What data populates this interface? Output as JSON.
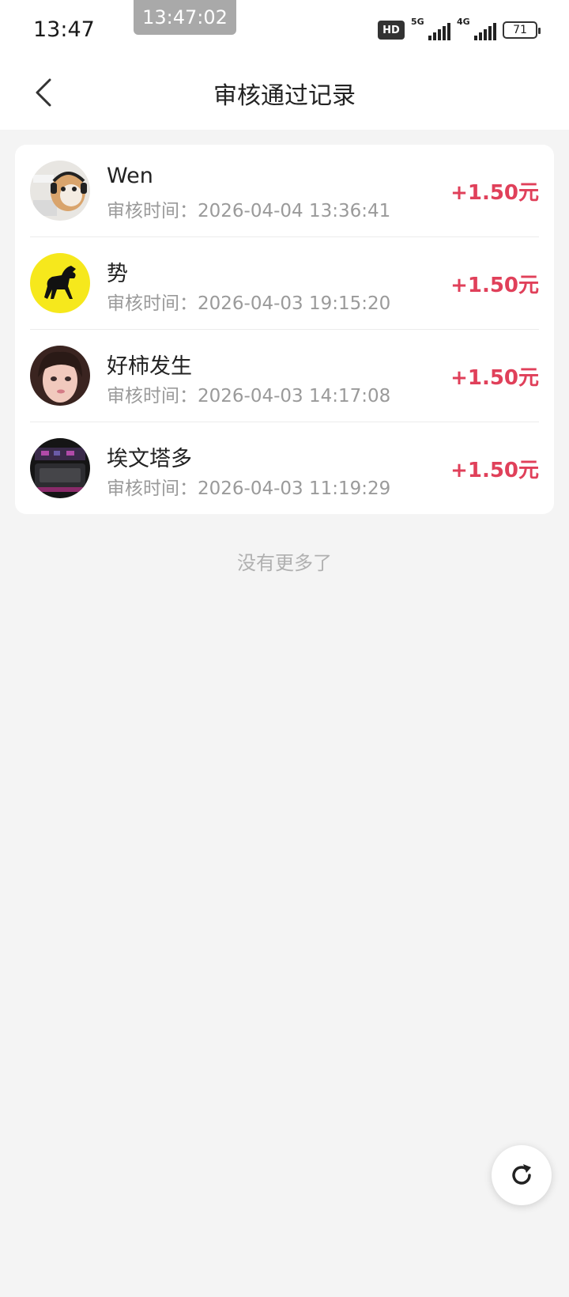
{
  "status_bar": {
    "time": "13:47",
    "clock_overlay": "13:47:02",
    "hd_label": "HD",
    "net1_label": "5G",
    "net2_label": "4G",
    "battery_level": "71"
  },
  "header": {
    "title": "审核通过记录",
    "back_icon": "chevron-left-icon"
  },
  "records": [
    {
      "name": "Wen",
      "time_label": "审核时间：",
      "time": "2026-04-04 13:36:41",
      "amount": "+1.50元"
    },
    {
      "name": "势",
      "time_label": "审核时间：",
      "time": "2026-04-03 19:15:20",
      "amount": "+1.50元"
    },
    {
      "name": "好柿发生",
      "time_label": "审核时间：",
      "time": "2026-04-03 14:17:08",
      "amount": "+1.50元"
    },
    {
      "name": "埃文塔多",
      "time_label": "审核时间：",
      "time": "2026-04-03 11:19:29",
      "amount": "+1.50元"
    }
  ],
  "footer": {
    "no_more": "没有更多了"
  },
  "fab": {
    "icon": "refresh-icon"
  },
  "colors": {
    "amount": "#e0405a",
    "background": "#f4f4f4",
    "card": "#ffffff"
  }
}
